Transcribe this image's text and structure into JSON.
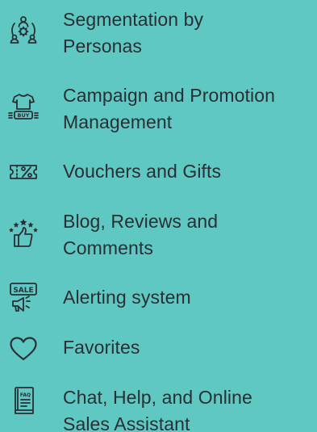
{
  "features": [
    {
      "line1": "Segmentation by",
      "line2": "Personas",
      "icon": "persona-segmentation-icon"
    },
    {
      "line1": "Campaign and Promotion",
      "line2": "Management",
      "icon": "tshirt-buy-icon"
    },
    {
      "line1": "Vouchers and Gifts",
      "line2": "",
      "icon": "voucher-percent-icon"
    },
    {
      "line1": "Blog, Reviews and",
      "line2": "Comments",
      "icon": "thumbs-up-stars-icon"
    },
    {
      "line1": "Alerting system",
      "line2": "",
      "icon": "sale-megaphone-icon"
    },
    {
      "line1": "Favorites",
      "line2": "",
      "icon": "heart-icon"
    },
    {
      "line1": "Chat, Help, and Online",
      "line2": "Sales Assistant",
      "icon": "faq-book-icon"
    }
  ]
}
